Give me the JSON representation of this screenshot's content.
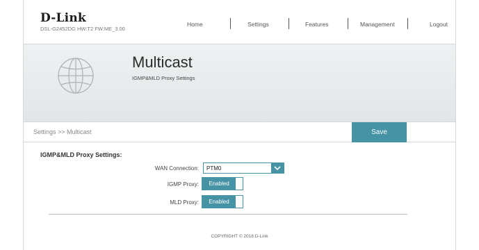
{
  "brand": {
    "logo": "D-Link",
    "firmware": "DSL-G2452DG  HW:T2  FW:ME_3.00"
  },
  "nav": [
    "Home",
    "Settings",
    "Features",
    "Management",
    "Logout"
  ],
  "banner": {
    "title": "Multicast",
    "subtitle": "IGMP&MLD Proxy Settings"
  },
  "breadcrumb": "Settings >> Multicast",
  "save_label": "Save",
  "form": {
    "section_title": "IGMP&MLD Proxy Settings:",
    "wan_label": "WAN Connection:",
    "wan_value": "PTM0",
    "igmp_label": "IGMP Proxy:",
    "igmp_value": "Enabled",
    "mld_label": "MLD Proxy:",
    "mld_value": "Enabled"
  },
  "footer": "COPYRIGHT © 2018 D-Link",
  "colors": {
    "accent": "#4593a5",
    "banner": "#e8ebec"
  }
}
